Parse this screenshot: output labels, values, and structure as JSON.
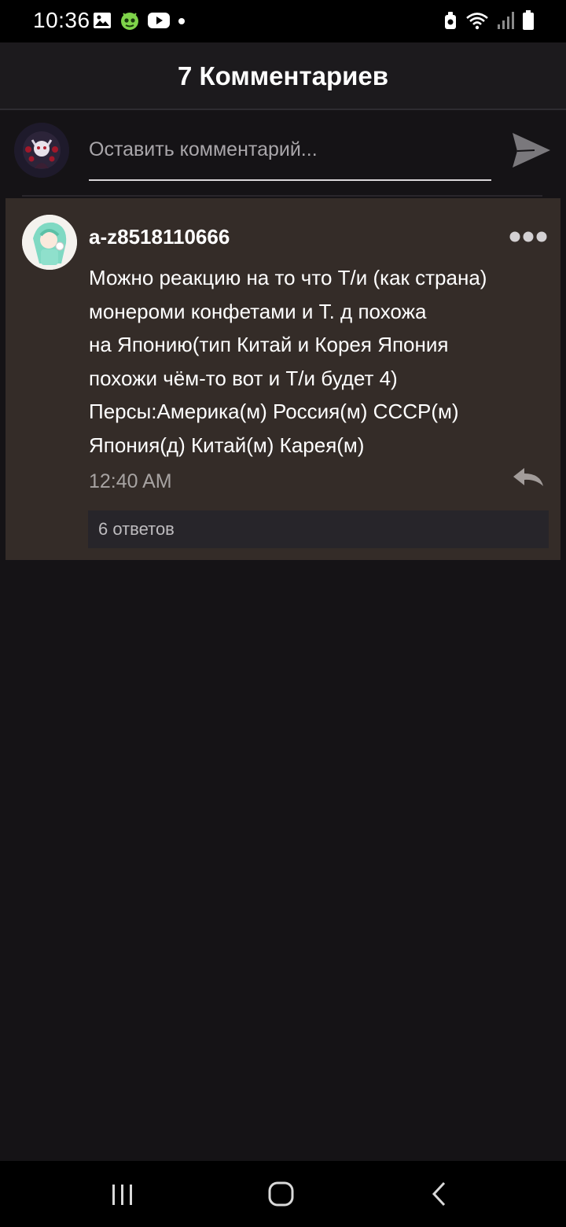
{
  "status_bar": {
    "time": "10:36",
    "icons_left": [
      "image-notification-icon",
      "android-app-icon",
      "youtube-icon",
      "dot-icon"
    ],
    "icons_right": [
      "data-saver-icon",
      "wifi-icon",
      "signal-icon",
      "battery-icon"
    ]
  },
  "header": {
    "title": "7 Комментариев"
  },
  "compose": {
    "placeholder": "Оставить комментарий..."
  },
  "comment": {
    "author": "a-z8518110666",
    "text": "Можно реакцию на то что Т/и (как страна)\nмонероми конфетами  и Т. д похожа\nна Японию(тип Китай и Корея Япония\nпохожи чём-то вот и Т/и будет 4)\nПерсы:Америка(м) Россия(м) СССР(м)\nЯпония(д) Китай(м) Карея(м)",
    "time": "12:40 AM",
    "replies_label": "6 ответов"
  },
  "colors": {
    "background": "#151316",
    "header": "#1c1a1d",
    "card": "#342c28",
    "replies_bar": "#27252a",
    "muted_text": "#a7a3a2"
  }
}
